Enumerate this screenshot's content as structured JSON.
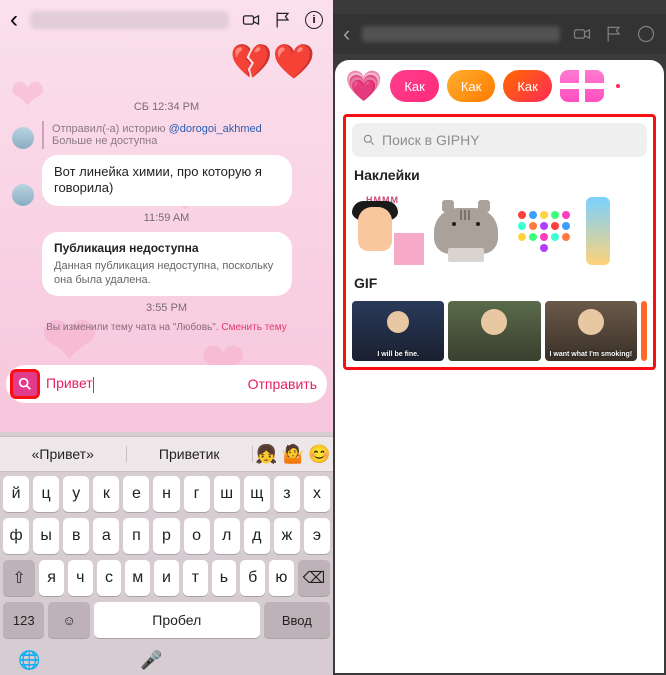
{
  "left": {
    "header": {
      "name_blurred": true
    },
    "top_hearts": [
      "💔",
      "❤️"
    ],
    "messages": {
      "ts1": "СБ 12:34 PM",
      "story": {
        "prefix": "Отправил(-а) историю ",
        "handle": "@dorogoi_akhmed",
        "note": "Больше не доступна"
      },
      "bubble1": "Вот линейка химии, про которую я говорила)",
      "ts2": "11:59 AM",
      "unavailable": {
        "title": "Публикация недоступна",
        "desc": "Данная публикация недоступна, поскольку она была удалена."
      },
      "ts3": "3:55 PM",
      "theme_change": {
        "text": "Вы изменили тему чата на \"Любовь\". ",
        "link": "Сменить тему"
      }
    },
    "input": {
      "value": "Привет",
      "send": "Отправить"
    },
    "keyboard": {
      "suggestions": [
        "«Привет»",
        "Приветик"
      ],
      "emoji_suggestions": [
        "👧",
        "🤷",
        "😊"
      ],
      "row1": [
        "й",
        "ц",
        "у",
        "к",
        "е",
        "н",
        "г",
        "ш",
        "щ",
        "з",
        "х"
      ],
      "row2": [
        "ф",
        "ы",
        "в",
        "а",
        "п",
        "р",
        "о",
        "л",
        "д",
        "ж",
        "э"
      ],
      "row3": [
        "я",
        "ч",
        "с",
        "м",
        "и",
        "т",
        "ь",
        "б",
        "ю"
      ],
      "bottom": {
        "num": "123",
        "space": "Пробел",
        "enter": "Ввод"
      }
    }
  },
  "right": {
    "pills": [
      "Как",
      "Как",
      "Как"
    ],
    "search_placeholder": "Поиск в GIPHY",
    "section_stickers": "Наклейки",
    "sticker1_label": "HMMM",
    "lights_colors": [
      "#ff3e3e",
      "#3e9dff",
      "#ffd23e",
      "#3eff7a",
      "#ff3ebd",
      "#3effd2",
      "#ff7a3e",
      "#b13eff"
    ],
    "section_gif": "GIF",
    "gif_captions": [
      "I will be fine.",
      "",
      "I want what I'm smoking!"
    ]
  }
}
